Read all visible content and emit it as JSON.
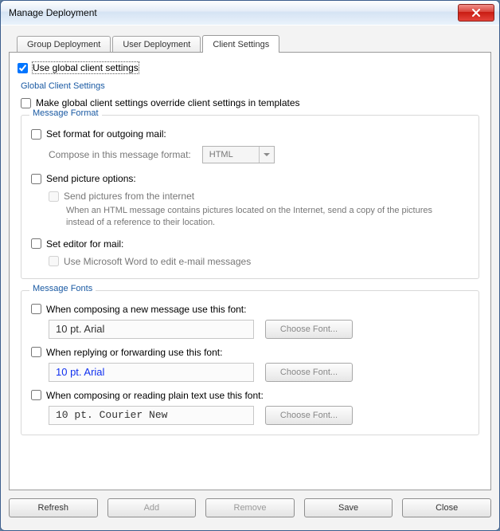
{
  "window": {
    "title": "Manage Deployment"
  },
  "tabs": {
    "group": "Group Deployment",
    "user": "User Deployment",
    "client": "Client Settings"
  },
  "global": {
    "use_global": "Use global client settings",
    "section_title": "Global Client Settings",
    "override": "Make global client settings override client settings in templates"
  },
  "msgfmt": {
    "legend": "Message Format",
    "set_format": "Set format for outgoing mail:",
    "compose_label": "Compose in this message format:",
    "compose_value": "HTML",
    "send_pic": "Send picture options:",
    "send_pic_sub": "Send pictures from the internet",
    "send_pic_desc": "When an HTML message contains pictures located on the Internet, send a copy of the pictures instead of a reference to their location.",
    "set_editor": "Set editor for mail:",
    "word_editor": "Use Microsoft Word to edit e-mail messages"
  },
  "fonts": {
    "legend": "Message Fonts",
    "compose_label": "When composing a new message use this font:",
    "compose_font": "10 pt. Arial",
    "reply_label": "When replying or forwarding use this font:",
    "reply_font": "10 pt. Arial",
    "plain_label": "When composing or reading plain text use this font:",
    "plain_font": "10 pt. Courier New",
    "choose": "Choose Font..."
  },
  "buttons": {
    "refresh": "Refresh",
    "add": "Add",
    "remove": "Remove",
    "save": "Save",
    "close": "Close"
  }
}
